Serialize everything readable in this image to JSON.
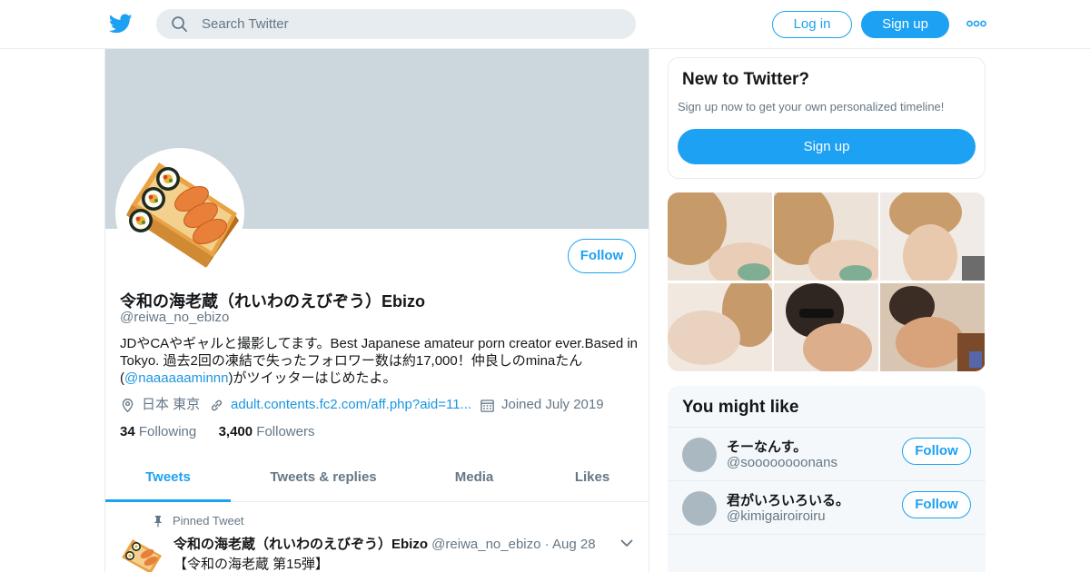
{
  "header": {
    "search_placeholder": "Search Twitter",
    "login_label": "Log in",
    "signup_label": "Sign up"
  },
  "profile": {
    "name": "令和の海老蔵（れいわのえびぞう）Ebizo",
    "handle": "@reiwa_no_ebizo",
    "follow_label": "Follow",
    "bio_text": "JDやCAやギャルと撮影してます。Best Japanese amateur porn creator ever.Based in Tokyo. 過去2回の凍結で失ったフォロワー数は約17,000！仲良しのminaたん",
    "bio_mention_open": "(",
    "bio_mention": "@naaaaaaminnn",
    "bio_tail": ")がツイッターはじめたよ。",
    "location": "日本 東京",
    "website": "adult.contents.fc2.com/aff.php?aid=11...",
    "joined": "Joined July 2019",
    "following_count": "34",
    "following_label": "Following",
    "followers_count": "3,400",
    "followers_label": "Followers"
  },
  "tabs": [
    "Tweets",
    "Tweets & replies",
    "Media",
    "Likes"
  ],
  "pinned_tweet": {
    "pinned_label": "Pinned Tweet",
    "name": "令和の海老蔵（れいわのえびぞう）Ebizo",
    "handle": "@reiwa_no_ebizo",
    "separator": "·",
    "date": "Aug 28",
    "text": "【令和の海老蔵 第15弾】"
  },
  "new_to_twitter": {
    "title": "New to Twitter?",
    "subtitle": "Sign up now to get your own personalized timeline!",
    "signup_label": "Sign up"
  },
  "you_might_like": {
    "title": "You might like",
    "users": [
      {
        "name": "そーなんす。",
        "handle": "@soooooooonans",
        "follow_label": "Follow"
      },
      {
        "name": "君がいろいろいる。",
        "handle": "@kimigairoiroiru",
        "follow_label": "Follow"
      }
    ]
  },
  "colors": {
    "accent": "#1da1f2",
    "banner": "#ccd6dd",
    "muted_text": "#657786",
    "link": "#1b95e0"
  },
  "icons": [
    "twitter-bird-icon",
    "search-icon",
    "more-icon",
    "location-icon",
    "link-icon",
    "calendar-icon",
    "pin-icon",
    "chevron-down-icon"
  ]
}
